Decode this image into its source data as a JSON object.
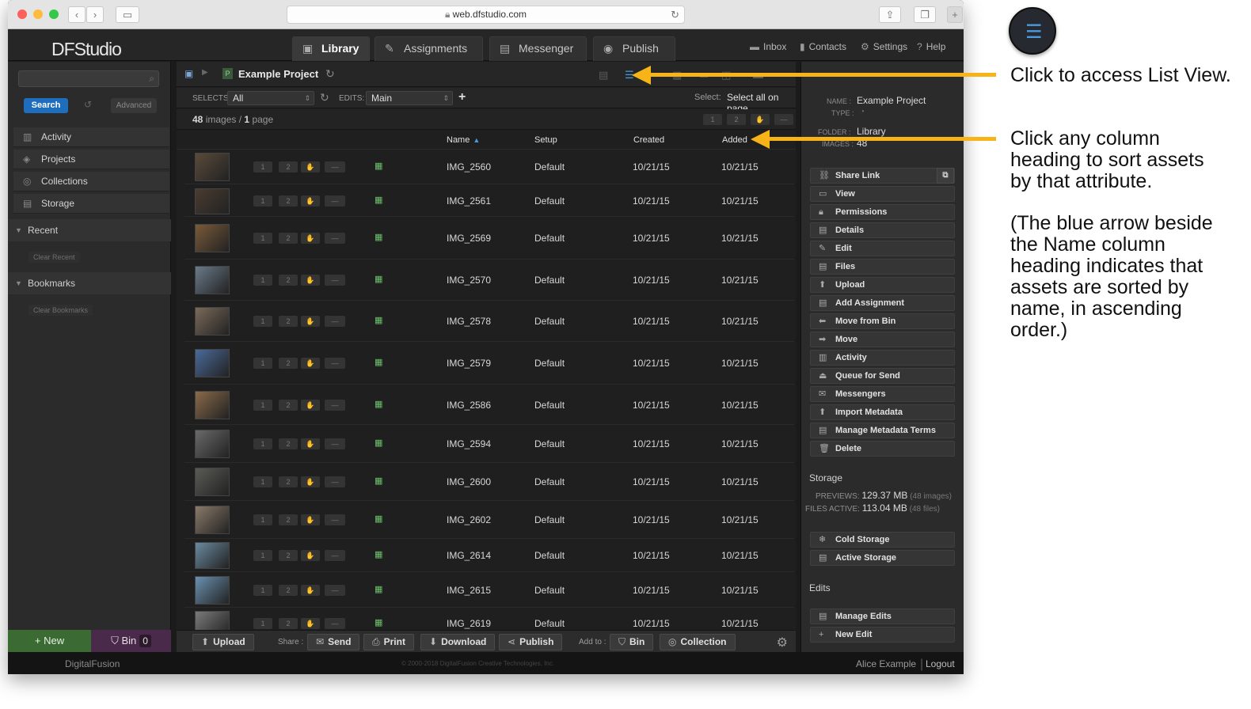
{
  "browser": {
    "url": "web.dfstudio.com"
  },
  "app": {
    "logo": "DFStudio",
    "tabs": [
      "Library",
      "Assignments",
      "Messenger",
      "Publish"
    ],
    "links": [
      "Inbox",
      "Contacts",
      "Settings",
      "Help"
    ]
  },
  "sidebar": {
    "search_button": "Search",
    "advanced_button": "Advanced",
    "items": [
      "Activity",
      "Projects",
      "Collections",
      "Storage"
    ],
    "recent": "Recent",
    "clear_recent": "Clear Recent",
    "bookmarks": "Bookmarks",
    "clear_bookmarks": "Clear Bookmarks",
    "new_button": "New",
    "bin_button": "Bin",
    "bin_count": "0"
  },
  "main": {
    "project_title": "Example Project",
    "project_badge": "P",
    "selects_label": "SELECTS:",
    "selects_value": "All",
    "edits_label": "EDITS:",
    "edits_value": "Main",
    "select_label": "Select:",
    "select_all": "Select all on page",
    "image_count": "48",
    "images_word": "images",
    "page_count": "1",
    "page_word": "page",
    "columns": [
      "Name",
      "Setup",
      "Created",
      "Added"
    ],
    "rows": [
      {
        "name": "IMG_2560",
        "setup": "Default",
        "created": "10/21/15",
        "added": "10/21/15"
      },
      {
        "name": "IMG_2561",
        "setup": "Default",
        "created": "10/21/15",
        "added": "10/21/15"
      },
      {
        "name": "IMG_2569",
        "setup": "Default",
        "created": "10/21/15",
        "added": "10/21/15"
      },
      {
        "name": "IMG_2570",
        "setup": "Default",
        "created": "10/21/15",
        "added": "10/21/15"
      },
      {
        "name": "IMG_2578",
        "setup": "Default",
        "created": "10/21/15",
        "added": "10/21/15"
      },
      {
        "name": "IMG_2579",
        "setup": "Default",
        "created": "10/21/15",
        "added": "10/21/15"
      },
      {
        "name": "IMG_2586",
        "setup": "Default",
        "created": "10/21/15",
        "added": "10/21/15"
      },
      {
        "name": "IMG_2594",
        "setup": "Default",
        "created": "10/21/15",
        "added": "10/21/15"
      },
      {
        "name": "IMG_2600",
        "setup": "Default",
        "created": "10/21/15",
        "added": "10/21/15"
      },
      {
        "name": "IMG_2602",
        "setup": "Default",
        "created": "10/21/15",
        "added": "10/21/15"
      },
      {
        "name": "IMG_2614",
        "setup": "Default",
        "created": "10/21/15",
        "added": "10/21/15"
      },
      {
        "name": "IMG_2615",
        "setup": "Default",
        "created": "10/21/15",
        "added": "10/21/15"
      },
      {
        "name": "IMG_2619",
        "setup": "Default",
        "created": "10/21/15",
        "added": "10/21/15"
      }
    ]
  },
  "bottom": {
    "upload": "Upload",
    "share_label": "Share :",
    "send": "Send",
    "print": "Print",
    "download": "Download",
    "publish": "Publish",
    "add_to_label": "Add to :",
    "bin": "Bin",
    "collection": "Collection"
  },
  "right": {
    "name_key": "NAME :",
    "name_val": "Example Project",
    "type_key": "TYPE :",
    "folder_key": "FOLDER :",
    "folder_val": "Library",
    "images_key": "IMAGES :",
    "images_val": "48",
    "actions": [
      "Share Link",
      "View",
      "Permissions",
      "Details",
      "Edit",
      "Files",
      "Upload",
      "Add Assignment",
      "Move from Bin",
      "Move",
      "Activity",
      "Queue for Send",
      "Messengers",
      "Import Metadata",
      "Manage Metadata Terms",
      "Delete"
    ],
    "storage_title": "Storage",
    "previews_key": "PREVIEWS:",
    "previews_val": "129.37 MB",
    "previews_note": "(48 images)",
    "files_key": "FILES ACTIVE:",
    "files_val": "113.04 MB",
    "files_note": "(48 files)",
    "storage_actions": [
      "Cold Storage",
      "Active Storage"
    ],
    "edits_title": "Edits",
    "edit_actions": [
      "Manage Edits",
      "New Edit"
    ]
  },
  "footer": {
    "logo": "DigitalFusion",
    "copyright": "© 2000-2018 DigitalFusion Creative Technologies, Inc.",
    "user": "Alice Example",
    "logout": "Logout"
  },
  "annotations": {
    "note1": "Click to access List View.",
    "note2_lines": [
      "Click any column",
      "heading to sort assets",
      "by that attribute."
    ],
    "note3_lines": [
      "(The blue arrow beside",
      "the Name column",
      "heading indicates that",
      "assets are sorted by",
      "name, in ascending",
      "order.)"
    ],
    "accent": "#f7b419",
    "list_icon_color": "#4a9ae0"
  }
}
